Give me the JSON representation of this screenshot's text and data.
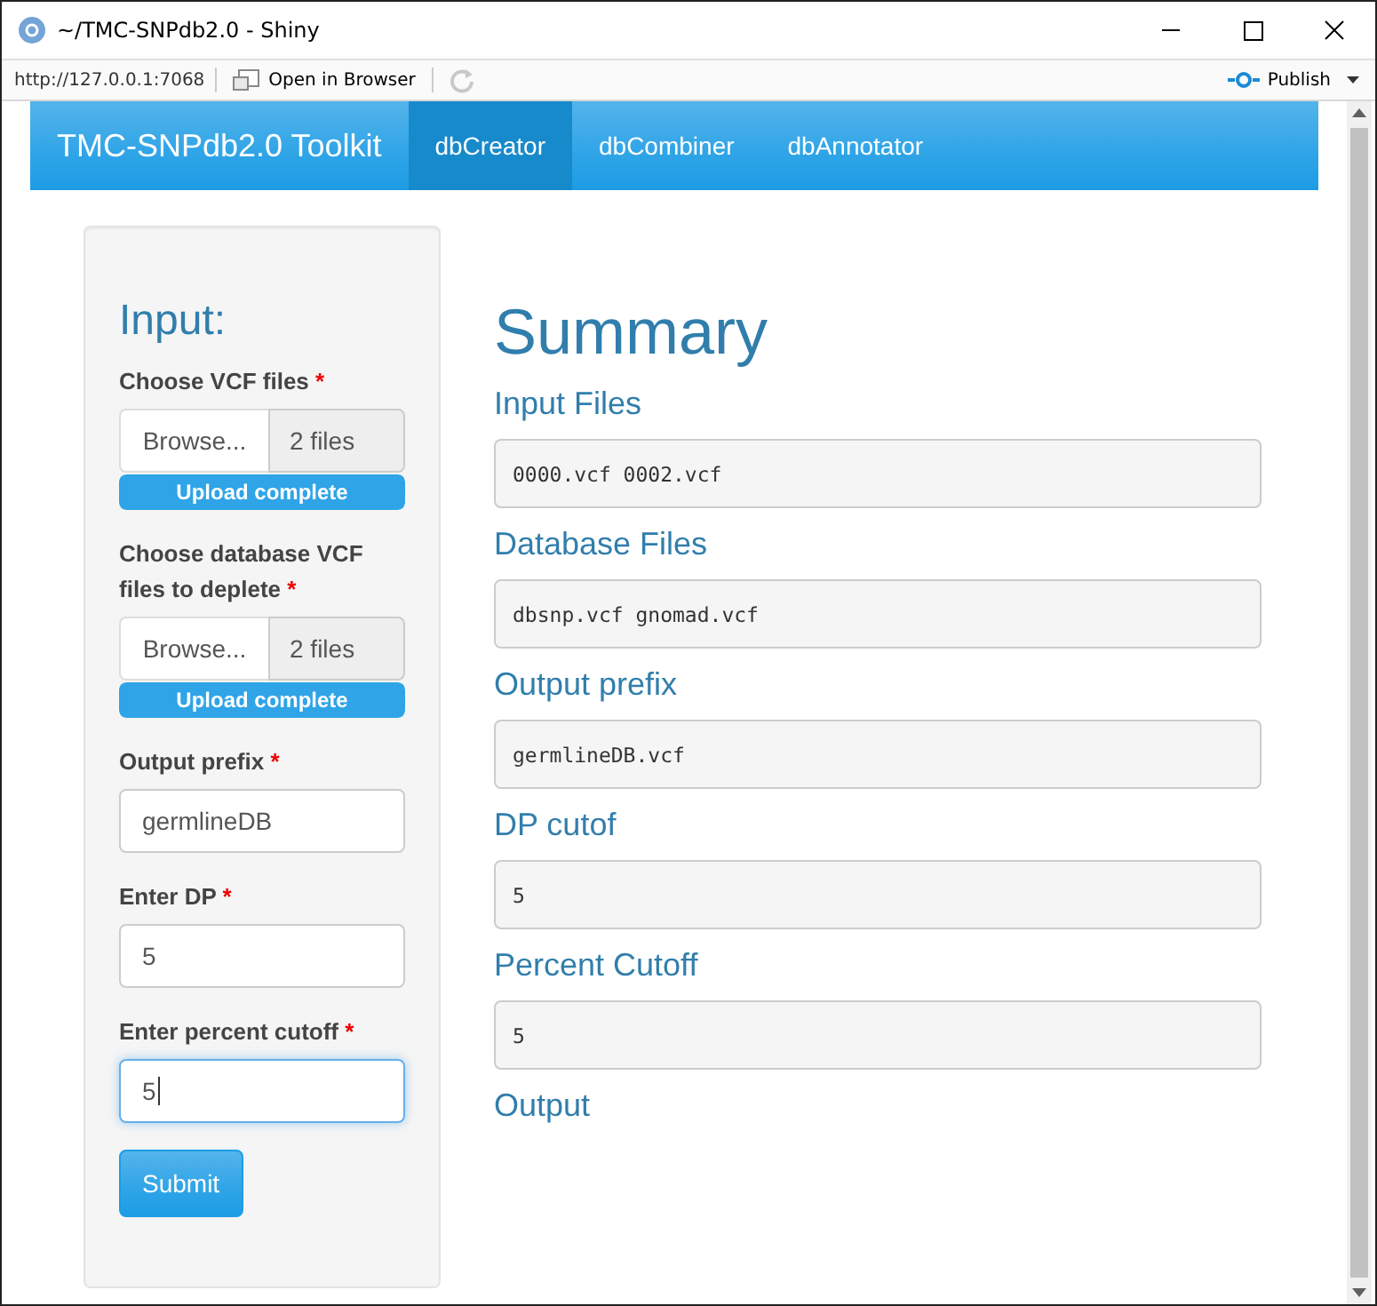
{
  "window": {
    "title": "~/TMC-SNPdb2.0 - Shiny"
  },
  "toolbar": {
    "url": "http://127.0.0.1:7068",
    "open_button": "Open in Browser",
    "publish_button": "Publish"
  },
  "navbar": {
    "brand": "TMC-SNPdb2.0 Toolkit",
    "tabs": [
      {
        "label": "dbCreator",
        "selected": true
      },
      {
        "label": "dbCombiner",
        "selected": false
      },
      {
        "label": "dbAnnotator",
        "selected": false
      }
    ]
  },
  "sidebar": {
    "heading": "Input:",
    "fields": [
      {
        "kind": "file",
        "label": "Choose VCF files",
        "mark": "*",
        "button": "Browse...",
        "value": "2 files",
        "progress": {
          "label": "Upload complete",
          "level": 1
        }
      },
      {
        "kind": "file",
        "label": "Choose database VCF files to deplete",
        "mark": "*",
        "button": "Browse...",
        "value": "2 files",
        "progress": {
          "label": "Upload complete",
          "level": 1
        }
      },
      {
        "kind": "text",
        "label": "Output prefix",
        "mark": "*",
        "value": "germlineDB",
        "focused": false
      },
      {
        "kind": "text",
        "label": "Enter DP",
        "mark": "*",
        "value": "5",
        "focused": false
      },
      {
        "kind": "text",
        "label": "Enter percent cutoff",
        "mark": "*",
        "value": "5",
        "focused": true
      }
    ],
    "submit": "Submit"
  },
  "summary": {
    "title": "Summary",
    "sections": [
      {
        "heading": "Input Files",
        "value": "0000.vcf 0002.vcf"
      },
      {
        "heading": "Database Files",
        "value": "dbsnp.vcf gnomad.vcf"
      },
      {
        "heading": "Output prefix",
        "value": "germlineDB.vcf"
      },
      {
        "heading": "DP cutof",
        "value": "5"
      },
      {
        "heading": "Percent Cutoff",
        "value": "5"
      },
      {
        "heading": "Output"
      }
    ]
  }
}
